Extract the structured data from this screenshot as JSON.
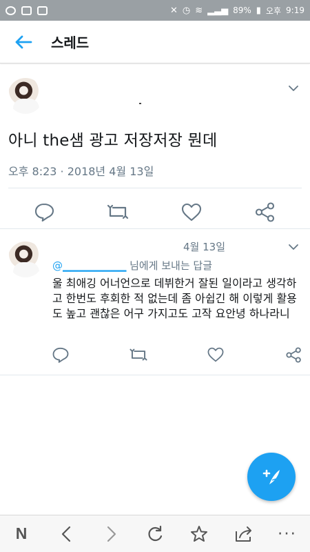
{
  "status_bar": {
    "battery": "89%",
    "period": "오후",
    "time": "9:19"
  },
  "header": {
    "title": "스레드"
  },
  "main_tweet": {
    "text": "아니 the샘 광고 저장저장 뭔데",
    "timestamp": "오후 8:23 · 2018년 4월 13일"
  },
  "reply": {
    "date": "4월 13일",
    "reply_prefix": "님에게 보내는 답글",
    "body": "울 최애깅 어너언으로 데뷔한거 잘된 일이라고 생각하고 한번도 후회한 적 없는데 좀 아쉽긴 해 이렇게 활용도 높고 괜찮은 어구 가지고도 고작 요안녕 하나라니"
  },
  "icons": {
    "back": "back-arrow-icon",
    "reply": "reply-icon",
    "retweet": "retweet-icon",
    "like": "heart-icon",
    "share": "share-icon",
    "compose": "compose-icon",
    "more": "more-icon"
  },
  "colors": {
    "accent": "#1da1f2",
    "text": "#14171a",
    "muted": "#657786",
    "status_bar": "#9aa0a4",
    "naver_green": "#00c73c"
  },
  "browser_bar": {
    "logo": "N",
    "more": "···"
  }
}
